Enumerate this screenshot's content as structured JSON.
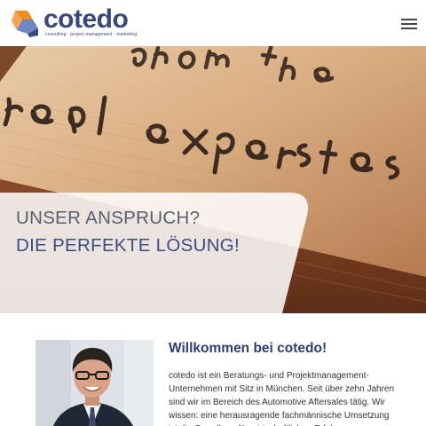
{
  "header": {
    "logo_text": "cotedo",
    "logo_tagline": "consulting · project management · marketing",
    "menu_icon": "hamburger-menu-icon"
  },
  "hero": {
    "background_words": "from the real experts",
    "headline_line1": "UNSER ANSPRUCH?",
    "headline_line2": "DIE PERFEKTE LÖSUNG!"
  },
  "welcome": {
    "title": "Willkommen bei cotedo!",
    "body": "cotedo ist ein Beratungs- und Projektmanagement-Unternehmen mit Sitz in München. Seit über zehn Jahren sind wir im Bereich des Automotive Aftersales tätig. Wir wissen: eine herausragende fachmännische Umsetzung ist die Grundlage für wirtschaftlichen Erfolg."
  },
  "colors": {
    "brand_navy": "#3a4a78",
    "logo_orange": "#f08a24",
    "logo_blue": "#6f86c2",
    "heading_grey": "#58606d"
  }
}
